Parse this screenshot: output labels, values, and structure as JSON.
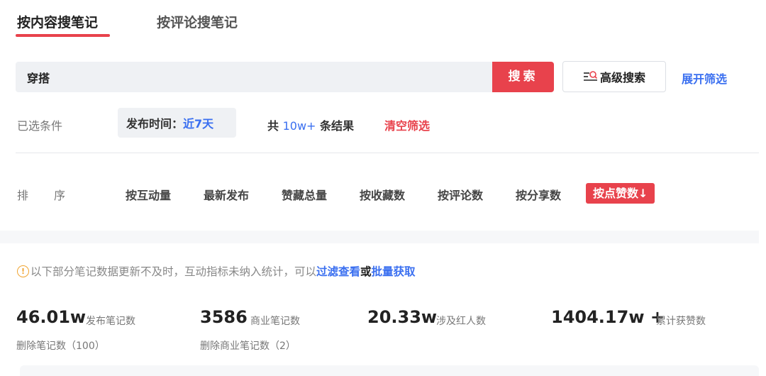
{
  "tabs": {
    "active": "按内容搜笔记",
    "inactive": "按评论搜笔记"
  },
  "search": {
    "value": "穿搭",
    "button": "搜索",
    "advanced": "高级搜索",
    "expand": "展开筛选"
  },
  "filters": {
    "selected_label": "已选条件",
    "chip_key": "发布时间：",
    "chip_value": "近7天",
    "total_prefix": "共",
    "total_count": "10w+",
    "total_suffix": "条结果",
    "clear": "清空筛选"
  },
  "sort": {
    "label": "排序",
    "items": [
      "按互动量",
      "最新发布",
      "赞藏总量",
      "按收藏数",
      "按评论数",
      "按分享数"
    ],
    "active": "按点赞数↓"
  },
  "notice": {
    "icon": "!",
    "text": "以下部分笔记数据更新不及时，互动指标未纳入统计，可以 ",
    "link1": "过滤查看",
    "mid": "或 ",
    "link2": "批量获取"
  },
  "stats": [
    {
      "value": "46.01w",
      "label": "发布笔记数",
      "sub": "删除笔记数（100）"
    },
    {
      "value": "3586",
      "label": "商业笔记数",
      "sub": "删除商业笔记数（2）"
    },
    {
      "value": "20.33w",
      "label": "涉及红人数",
      "sub": ""
    },
    {
      "value": "1404.17w +",
      "label": "累计获赞数",
      "sub": ""
    }
  ],
  "colors": {
    "accent": "#e8424c",
    "link": "#3a6ff0",
    "warning": "#f0a431"
  }
}
